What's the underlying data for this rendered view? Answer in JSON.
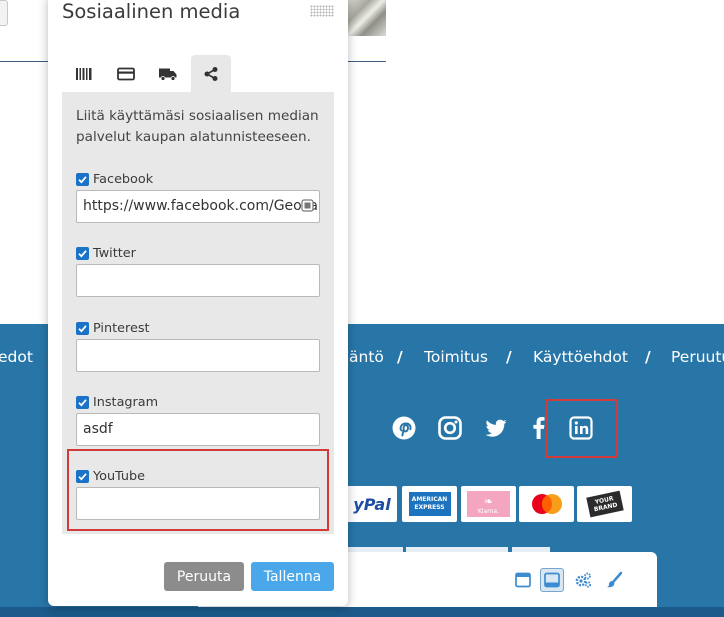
{
  "dialog": {
    "title": "Sosiaalinen media",
    "tabs": [
      {
        "icon": "barcode-icon",
        "active": false
      },
      {
        "icon": "credit-card-icon",
        "active": false
      },
      {
        "icon": "truck-icon",
        "active": false
      },
      {
        "icon": "share-icon",
        "active": true
      }
    ],
    "description": "Liitä käyttämäsi sosiaalisen median palvelut kaupan alatunnisteeseen.",
    "fields": [
      {
        "label": "Facebook",
        "checked": true,
        "value": "https://www.facebook.com/Geocart"
      },
      {
        "label": "Twitter",
        "checked": true,
        "value": ""
      },
      {
        "label": "Pinterest",
        "checked": true,
        "value": ""
      },
      {
        "label": "Instagram",
        "checked": true,
        "value": "asdf"
      },
      {
        "label": "YouTube",
        "checked": true,
        "value": ""
      }
    ],
    "cancel_label": "Peruuta",
    "save_label": "Tallenna"
  },
  "footer": {
    "links": [
      "edot",
      "äntö",
      "Toimitus",
      "Käyttöehdot",
      "Peruutu"
    ],
    "separator": "/",
    "social_icons": [
      "pinterest-icon",
      "instagram-icon",
      "twitter-icon",
      "facebook-icon",
      "linkedin-icon"
    ],
    "payment_logos": [
      "paypal",
      "american-express",
      "klarna",
      "mastercard",
      "your-brand"
    ],
    "payment_texts": {
      "paypal": "yPal",
      "amex_top": "AMERICAN",
      "amex_bottom": "EXPRESS",
      "klarna": "Klarna.",
      "brand_top": "YOUR",
      "brand_bottom": "BRAND"
    }
  },
  "toolbar": {
    "buttons": [
      "layout-window-icon",
      "layout-bottom-icon",
      "settings-icon",
      "brush-icon"
    ],
    "active_button": "layout-bottom-icon"
  },
  "colors": {
    "footer_bg": "#2876a8",
    "checkbox": "#1a73c6",
    "save_button": "#4aa8ea",
    "cancel_button": "#8c8c8c",
    "highlight": "#d33a3a"
  }
}
